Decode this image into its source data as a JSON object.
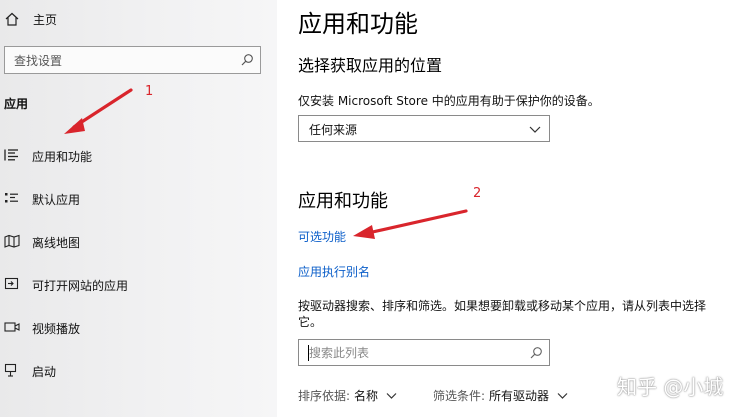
{
  "sidebar": {
    "home_label": "主页",
    "search_placeholder": "查找设置",
    "section_label": "应用",
    "items": [
      {
        "label": "应用和功能",
        "icon": "apps-features-icon"
      },
      {
        "label": "默认应用",
        "icon": "default-apps-icon"
      },
      {
        "label": "离线地图",
        "icon": "offline-maps-icon"
      },
      {
        "label": "可打开网站的应用",
        "icon": "apps-for-websites-icon"
      },
      {
        "label": "视频播放",
        "icon": "video-playback-icon"
      },
      {
        "label": "启动",
        "icon": "startup-icon"
      }
    ]
  },
  "main": {
    "title": "应用和功能",
    "install_heading": "选择获取应用的位置",
    "install_desc": "仅安装 Microsoft Store 中的应用有助于保护你的设备。",
    "install_dropdown_value": "任何来源",
    "apps_heading": "应用和功能",
    "optional_features_link": "可选功能",
    "app_alias_link": "应用执行别名",
    "search_desc": "按驱动器搜索、排序和筛选。如果想要卸载或移动某个应用，请从列表中选择它。",
    "list_search_placeholder": "搜索此列表",
    "sort_label": "排序依据:",
    "sort_value": "名称",
    "filter_label": "筛选条件:",
    "filter_value": "所有驱动器"
  },
  "annotations": {
    "arrow1_number": "1",
    "arrow2_number": "2",
    "color": "#d9252c"
  },
  "watermark": "知乎 @小城",
  "colors": {
    "link": "#0b5ec9",
    "sidebar_bg": "#eeeeef"
  }
}
